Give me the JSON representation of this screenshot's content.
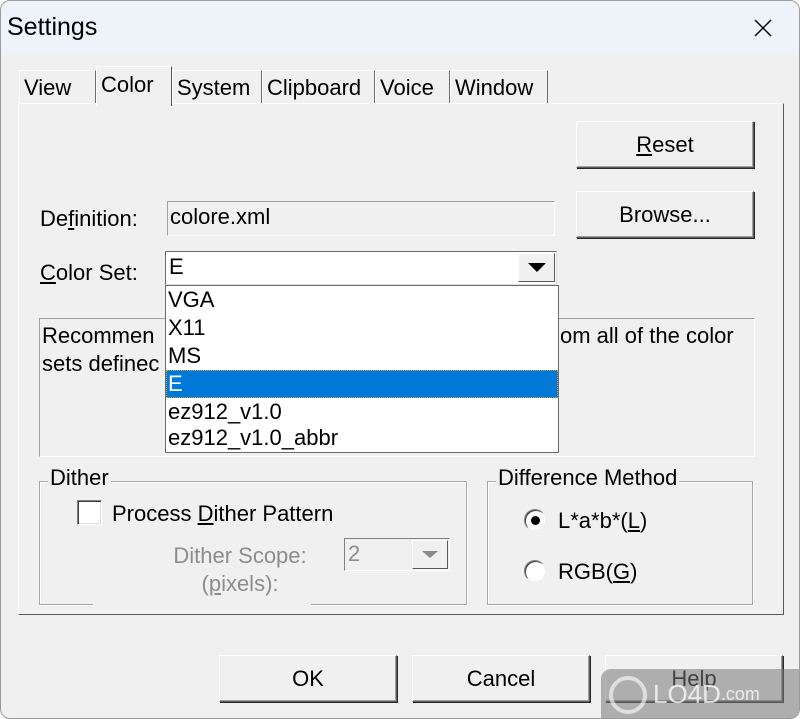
{
  "window": {
    "title": "Settings",
    "close_label": "X"
  },
  "tabs": [
    {
      "label": "View",
      "active": false
    },
    {
      "label": "Color",
      "active": true
    },
    {
      "label": "System",
      "active": false
    },
    {
      "label": "Clipboard",
      "active": false
    },
    {
      "label": "Voice",
      "active": false
    },
    {
      "label": "Window",
      "active": false
    }
  ],
  "color_tab": {
    "reset_button": {
      "pre": "",
      "accel": "R",
      "post": "eset"
    },
    "browse_button": "Browse...",
    "definition": {
      "label_pre": "De",
      "label_accel": "f",
      "label_post": "inition:",
      "value": "colore.xml"
    },
    "color_set": {
      "label_pre": "",
      "label_accel": "C",
      "label_post": "olor Set:",
      "value": "E",
      "options": [
        "VGA",
        "X11",
        "MS",
        "E",
        "ez912_v1.0",
        "ez912_v1.0_abbr"
      ],
      "selected_index": 3
    },
    "description": {
      "line1_left": "Recommen",
      "line1_right": "om all of the color",
      "line2_left": "sets definec"
    },
    "dither": {
      "group_title": "Dither",
      "checkbox": {
        "pre": "Process ",
        "accel": "D",
        "post": "ither Pattern",
        "checked": false
      },
      "scope_label_line1": "Dither Scope:",
      "scope_label_line2_pre": "(",
      "scope_label_line2_accel": "p",
      "scope_label_line2_post": "ixels):",
      "scope_value": "2"
    },
    "difference_method": {
      "group_title": "Difference Method",
      "options": [
        {
          "pre": "L*a*b*(",
          "accel": "L",
          "post": ")",
          "selected": true
        },
        {
          "pre": "RGB(",
          "accel": "G",
          "post": ")",
          "selected": false
        }
      ]
    }
  },
  "footer": {
    "ok": "OK",
    "cancel": "Cancel",
    "help": "Help"
  },
  "watermark": {
    "text": "LO4D",
    "suffix": ".com"
  }
}
